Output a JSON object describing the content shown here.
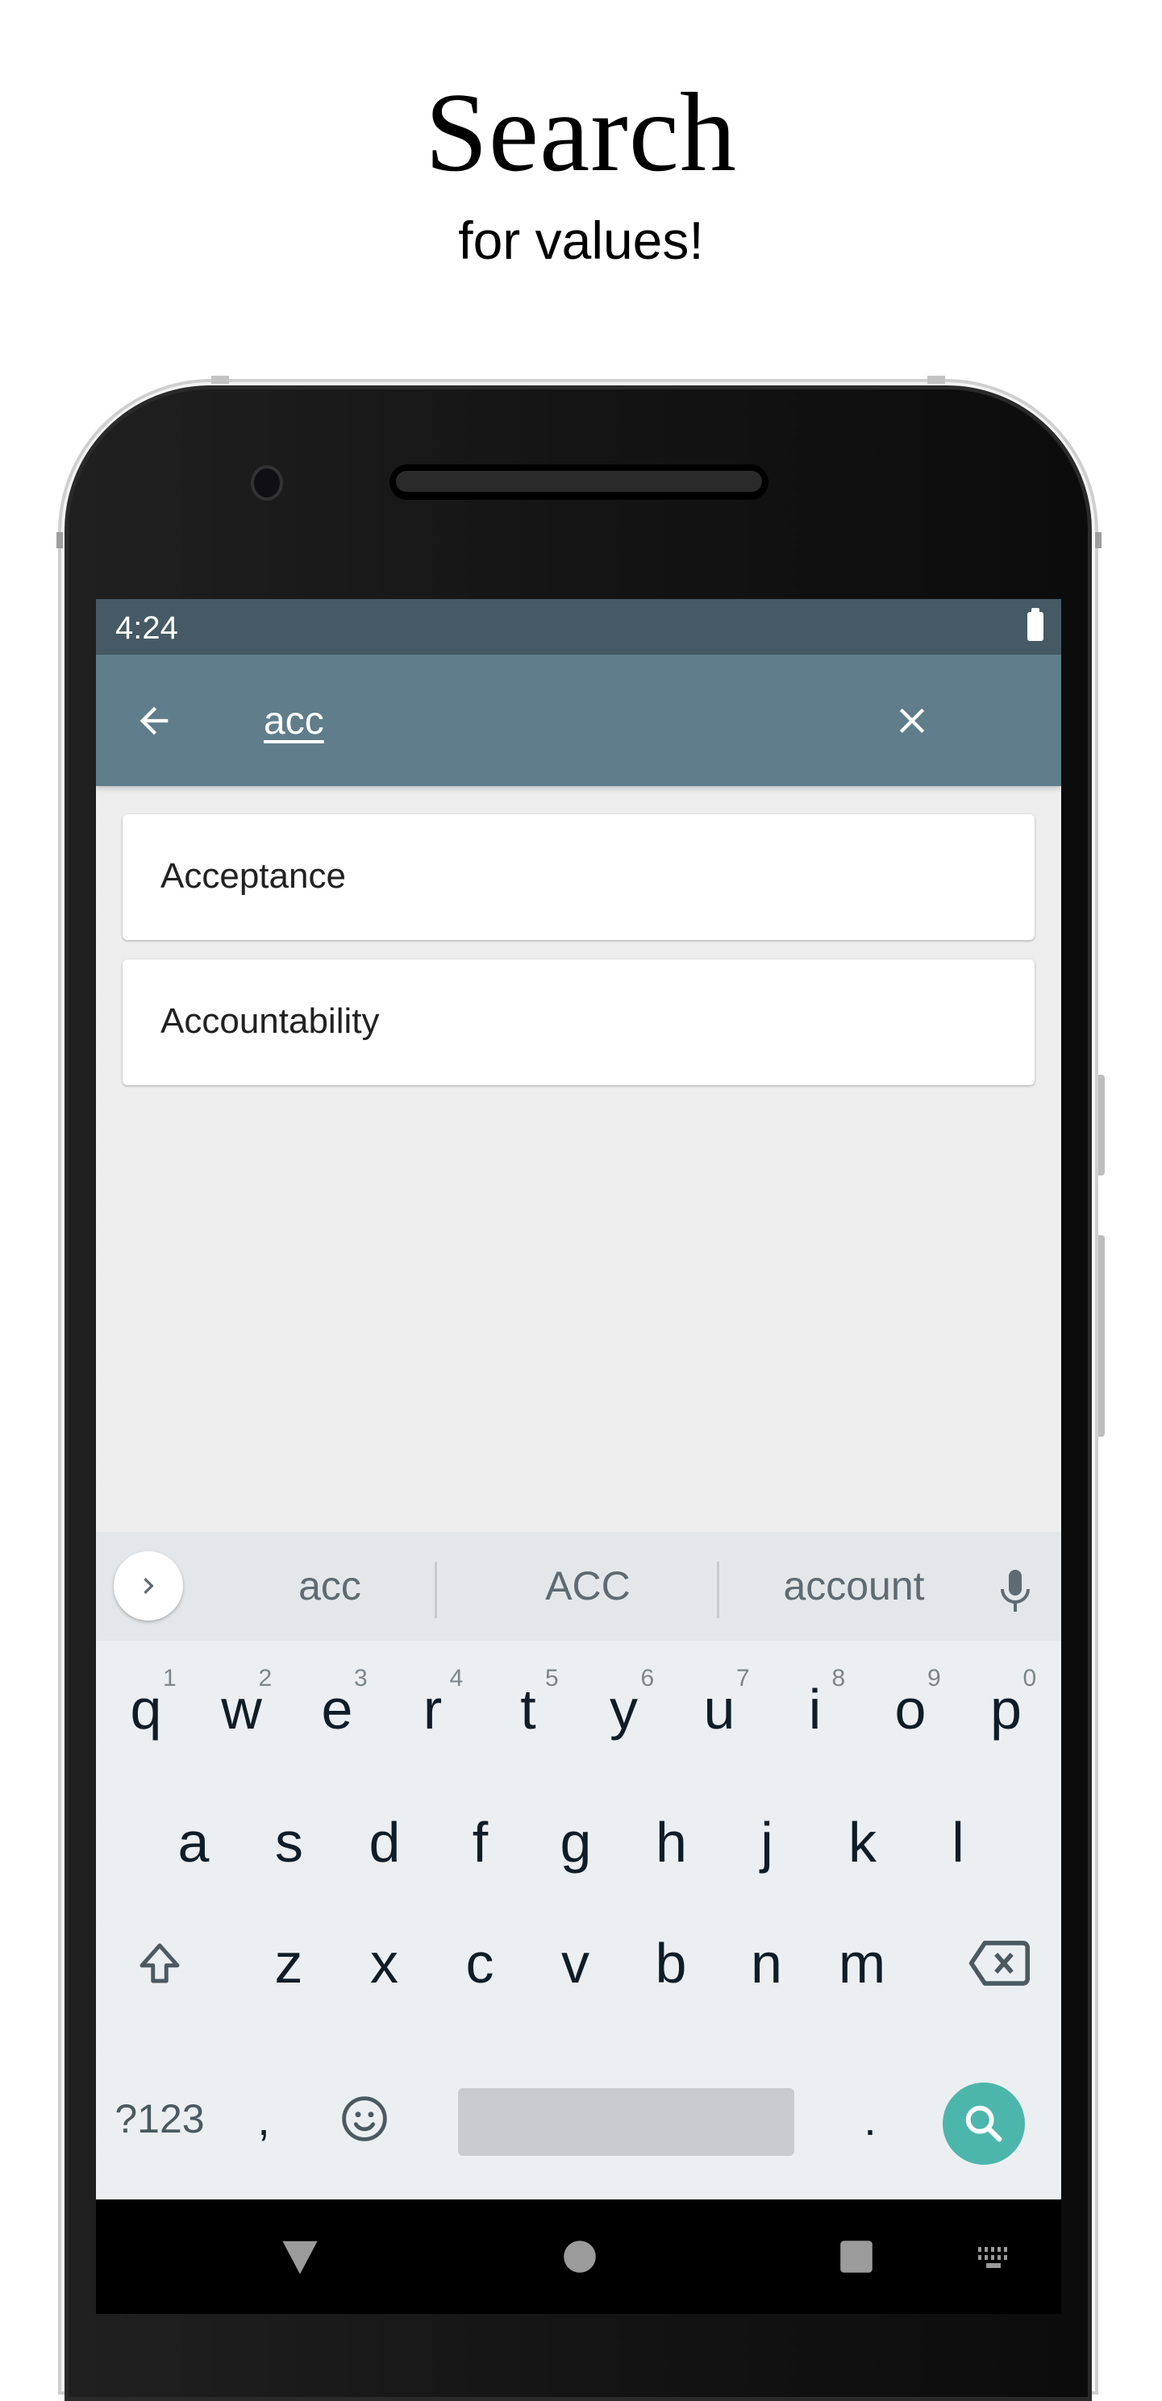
{
  "promo": {
    "headline": "Search",
    "subline": "for values!"
  },
  "status_bar": {
    "time": "4:24",
    "battery_icon": "battery-full-icon"
  },
  "app_bar": {
    "back_icon": "arrow-left-icon",
    "search_value": "acc",
    "clear_icon": "close-icon",
    "background_color": "#607d8b"
  },
  "results": [
    {
      "label": "Acceptance"
    },
    {
      "label": "Accountability"
    }
  ],
  "keyboard": {
    "suggestions": [
      "acc",
      "ACC",
      "account"
    ],
    "expand_icon": "chevron-right-icon",
    "mic_icon": "microphone-icon",
    "row1": [
      {
        "letter": "q",
        "hint": "1"
      },
      {
        "letter": "w",
        "hint": "2"
      },
      {
        "letter": "e",
        "hint": "3"
      },
      {
        "letter": "r",
        "hint": "4"
      },
      {
        "letter": "t",
        "hint": "5"
      },
      {
        "letter": "y",
        "hint": "6"
      },
      {
        "letter": "u",
        "hint": "7"
      },
      {
        "letter": "i",
        "hint": "8"
      },
      {
        "letter": "o",
        "hint": "9"
      },
      {
        "letter": "p",
        "hint": "0"
      }
    ],
    "row2": [
      "a",
      "s",
      "d",
      "f",
      "g",
      "h",
      "j",
      "k",
      "l"
    ],
    "row3": [
      "z",
      "x",
      "c",
      "v",
      "b",
      "n",
      "m"
    ],
    "shift_icon": "shift-icon",
    "backspace_icon": "backspace-icon",
    "symbols_label": "?123",
    "comma_label": ",",
    "emoji_icon": "emoji-icon",
    "period_label": ".",
    "action_icon": "search-icon",
    "action_color": "#4db6ac"
  },
  "nav_bar": {
    "back_icon": "nav-back-icon",
    "home_icon": "nav-home-icon",
    "recents_icon": "nav-recents-icon",
    "keyboard_switch_icon": "keyboard-icon"
  }
}
